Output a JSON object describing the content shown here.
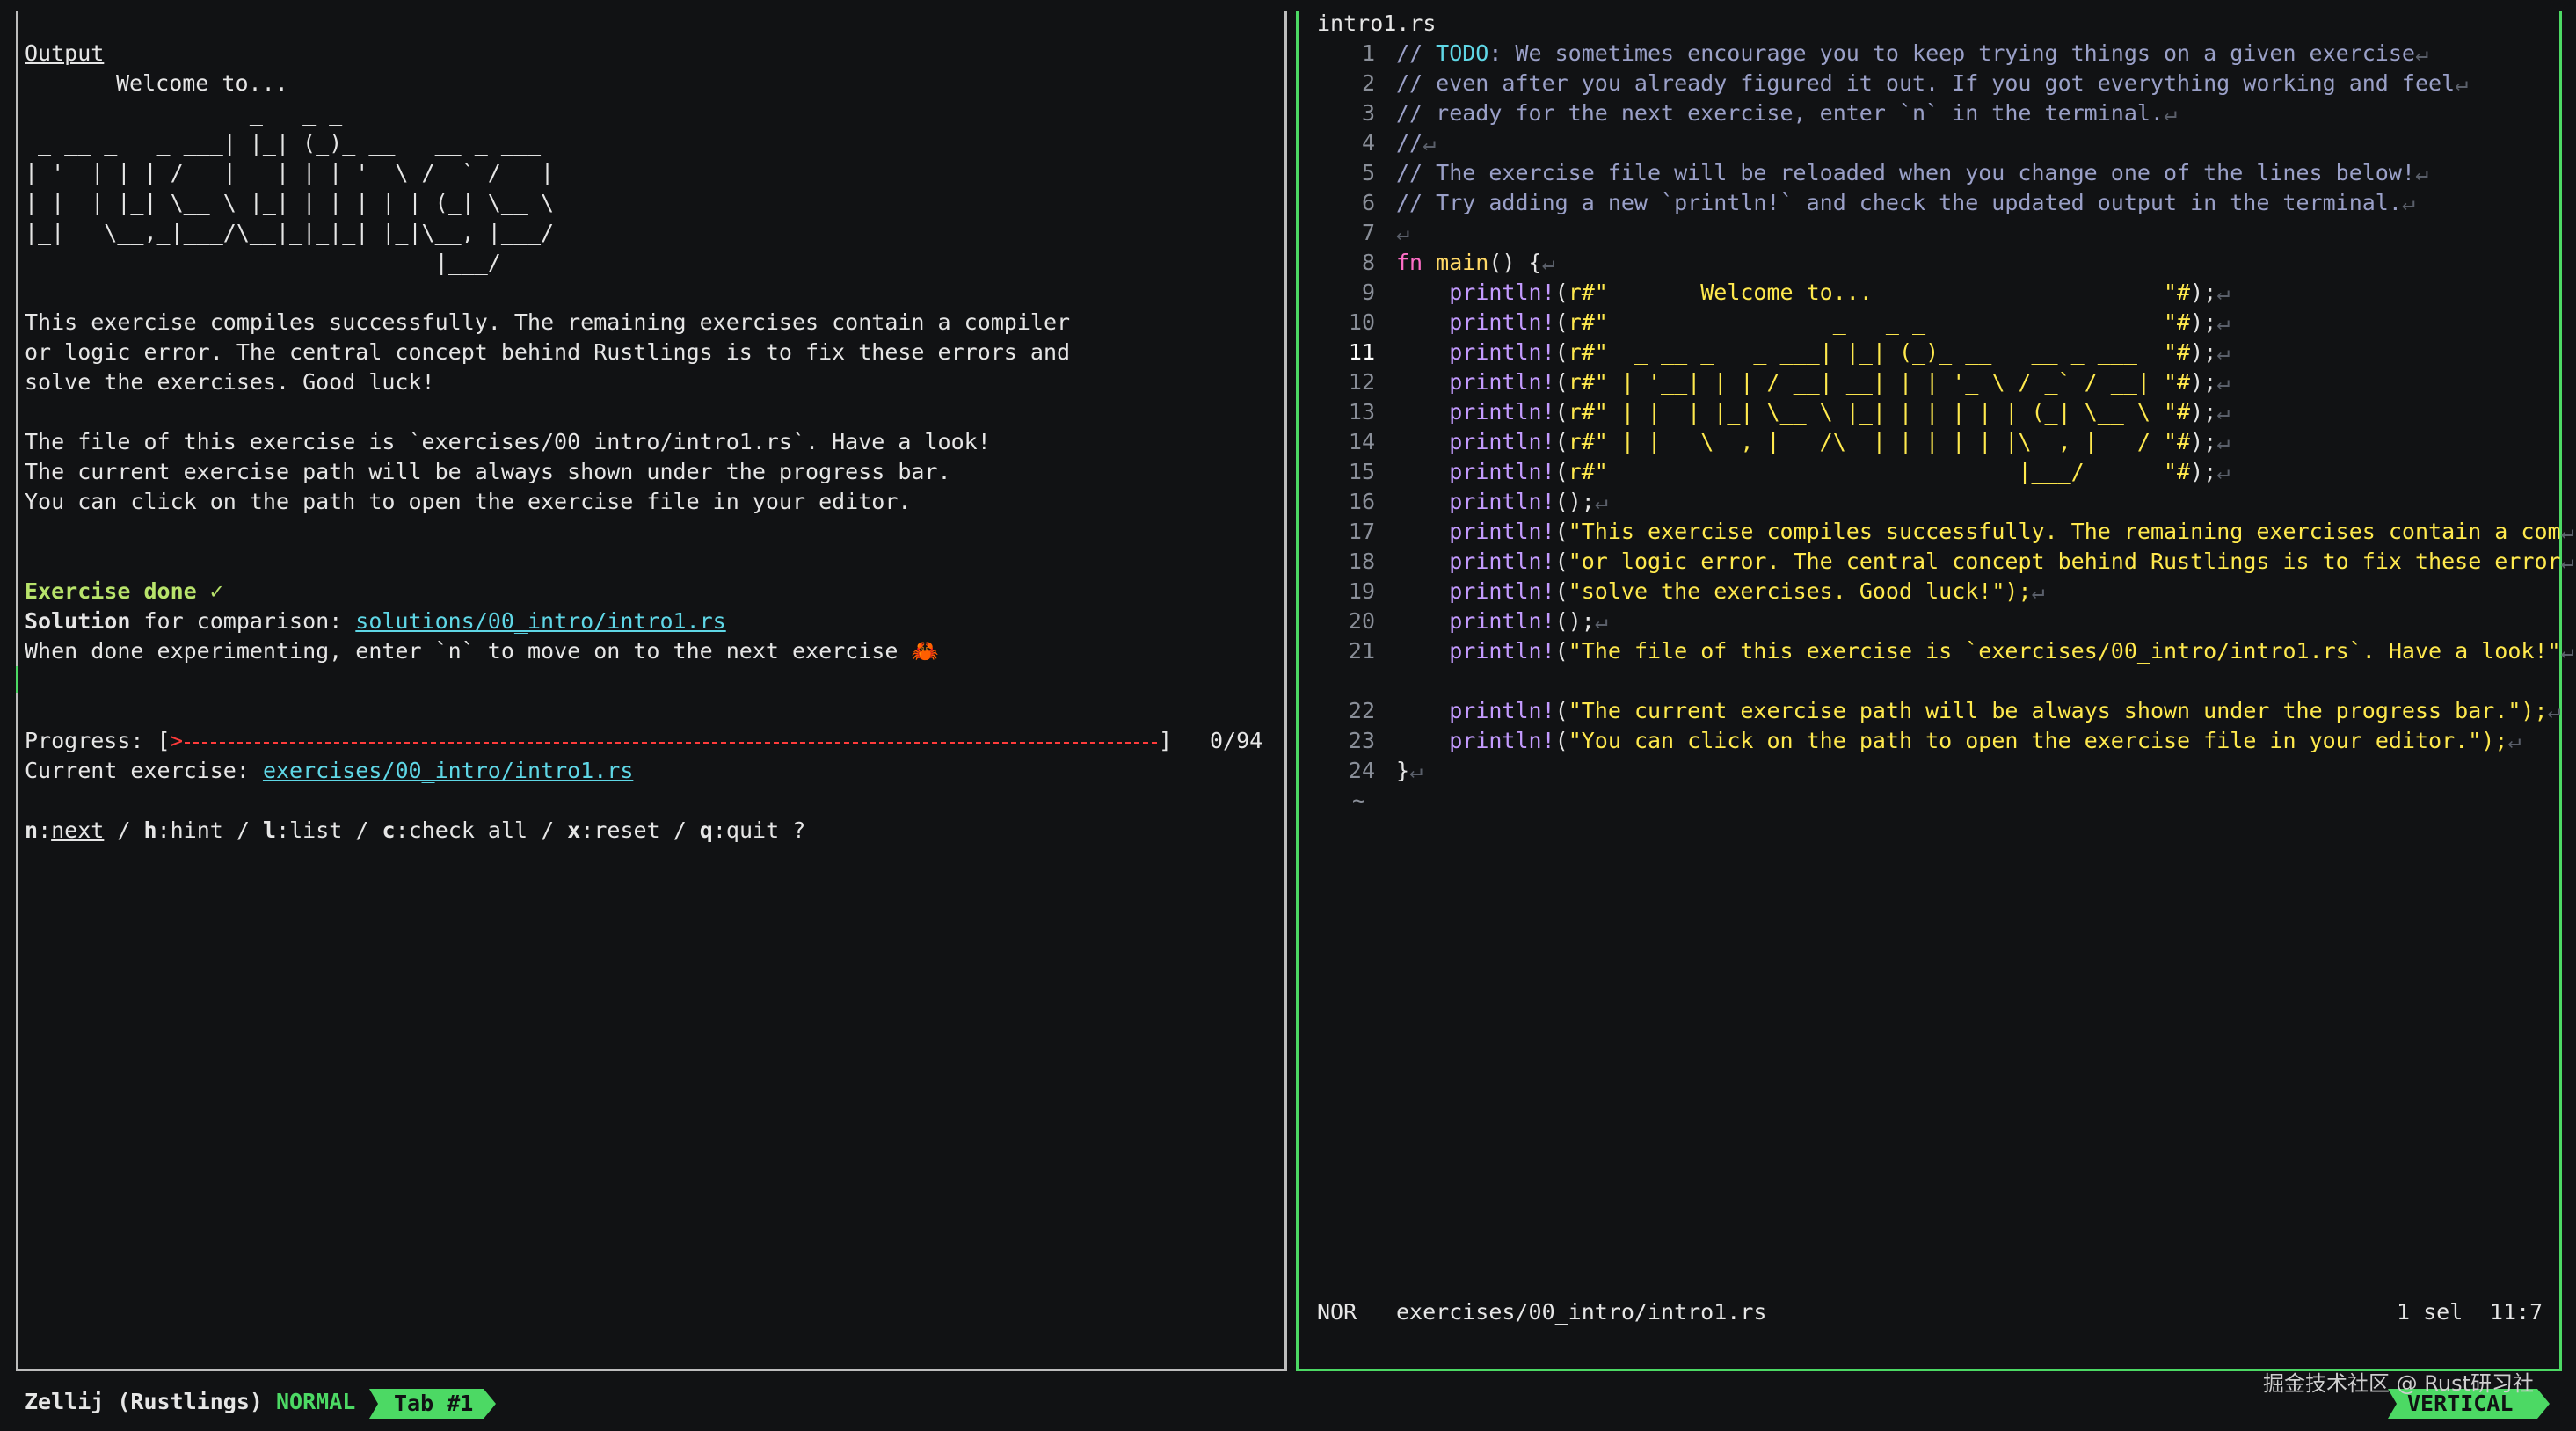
{
  "left": {
    "title": "Output",
    "welcome": "Welcome to...",
    "art": [
      "                 _   _ _",
      " _ __ _   _ ___| |_| (_)_ __   __ _ ___",
      "| '__| | | / __| __| | | '_ \\ / _` / __|",
      "| |  | |_| \\__ \\ |_| | | | | | (_| \\__ \\",
      "|_|   \\__,_|___/\\__|_|_|_| |_|\\__, |___/",
      "                               |___/"
    ],
    "para1": [
      "This exercise compiles successfully. The remaining exercises contain a compiler",
      "or logic error. The central concept behind Rustlings is to fix these errors and",
      "solve the exercises. Good luck!"
    ],
    "para2": [
      "The file of this exercise is `exercises/00_intro/intro1.rs`. Have a look!",
      "The current exercise path will be always shown under the progress bar.",
      "You can click on the path to open the exercise file in your editor."
    ],
    "exercise_done": "Exercise done ✓",
    "solution_label": "Solution",
    "solution_mid": " for comparison: ",
    "solution_path": "solutions/00_intro/intro1.rs",
    "done_text": "When done experimenting, enter `n` to move on to the next exercise ",
    "crab": "🦀",
    "progress_label": "Progress: [",
    "progress_head": ">",
    "progress_end": "]",
    "progress_count": "0/94",
    "progress_fraction": 0.0,
    "current_label": "Current exercise: ",
    "current_path": "exercises/00_intro/intro1.rs",
    "menu": [
      {
        "key": "n",
        "label": "next"
      },
      {
        "key": "h",
        "label": "hint"
      },
      {
        "key": "l",
        "label": "list"
      },
      {
        "key": "c",
        "label": "check all"
      },
      {
        "key": "x",
        "label": "reset"
      },
      {
        "key": "q",
        "label": "quit"
      }
    ],
    "menu_tail": " ?"
  },
  "editor": {
    "filename": "intro1.rs",
    "cursor_line": 11,
    "lines": [
      {
        "n": "1",
        "t": "comment",
        "text": "TODO",
        "rest": ": We sometimes encourage you to keep trying things on a given exercise"
      },
      {
        "n": "2",
        "t": "comment",
        "text": "// even after you already figured it out. If you got everything working and feel"
      },
      {
        "n": "3",
        "t": "comment",
        "text": "// ready for the next exercise, enter `n` in the terminal."
      },
      {
        "n": "4",
        "t": "comment",
        "text": "//"
      },
      {
        "n": "5",
        "t": "comment",
        "text": "// The exercise file will be reloaded when you change one of the lines below!"
      },
      {
        "n": "6",
        "t": "comment",
        "text": "// Try adding a new `println!` and check the updated output in the terminal."
      },
      {
        "n": "7",
        "t": "blank",
        "text": ""
      },
      {
        "n": "8",
        "t": "fnmain",
        "text": "fn main() {"
      },
      {
        "n": "9",
        "t": "raw",
        "text": "       Welcome to...                      "
      },
      {
        "n": "10",
        "t": "raw",
        "text": "                 _   _ _                  "
      },
      {
        "n": "11",
        "t": "raw",
        "text": "  _ __ _   _ ___| |_| (_)_ __   __ _ ___  "
      },
      {
        "n": "12",
        "t": "raw",
        "text": " | '__| | | / __| __| | | '_ \\ / _` / __| "
      },
      {
        "n": "13",
        "t": "raw",
        "text": " | |  | |_| \\__ \\ |_| | | | | | (_| \\__ \\ "
      },
      {
        "n": "14",
        "t": "raw",
        "text": " |_|   \\__,_|___/\\__|_|_|_| |_|\\__, |___/ "
      },
      {
        "n": "15",
        "t": "raw",
        "text": "                               |___/      "
      },
      {
        "n": "16",
        "t": "empty",
        "text": "println!();"
      },
      {
        "n": "17",
        "t": "str",
        "text": "\"This exercise compiles successfully. The remaining exercises contain a com"
      },
      {
        "n": "18",
        "t": "str",
        "text": "\"or logic error. The central concept behind Rustlings is to fix these error"
      },
      {
        "n": "19",
        "t": "str",
        "text": "\"solve the exercises. Good luck!\");"
      },
      {
        "n": "20",
        "t": "empty",
        "text": "println!();"
      },
      {
        "n": "21",
        "t": "str",
        "text": "\"The file of this exercise is `exercises/00_intro/intro1.rs`. Have a look!\""
      },
      {
        "n": "22",
        "t": "str",
        "text": "\"The current exercise path will be always shown under the progress bar.\");"
      },
      {
        "n": "23",
        "t": "str",
        "text": "\"You can click on the path to open the exercise file in your editor.\");"
      },
      {
        "n": "24",
        "t": "close",
        "text": "}"
      }
    ],
    "tilde": "~",
    "mode": "NOR",
    "path": "exercises/00_intro/intro1.rs",
    "selection": "1 sel",
    "position": "11:7"
  },
  "statusbar": {
    "session": "Zellij (Rustlings)",
    "mode": "NORMAL",
    "tab": "Tab #1",
    "layout": "VERTICAL",
    "watermark": "掘金技术社区 @ Rust研习社"
  },
  "colors": {
    "green": "#4cd964",
    "accent": "#5fd7e6",
    "danger": "#ff3b3b"
  }
}
